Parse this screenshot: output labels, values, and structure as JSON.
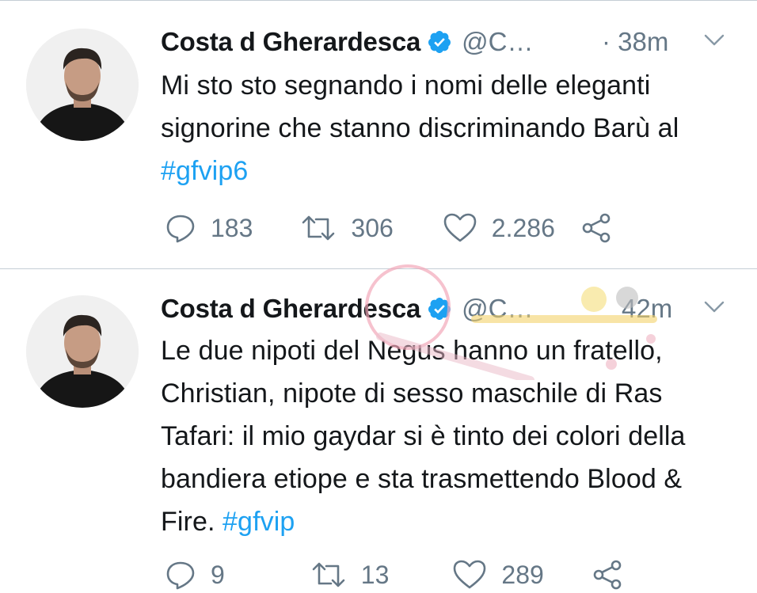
{
  "tweets": [
    {
      "name": "Costa d Gherardesca",
      "handle": "@C…",
      "time": "· 38m",
      "text_plain": "Mi sto sto segnando i nomi delle eleganti signorine che stanno discriminando Barù al ",
      "hashtag": "#gfvip6",
      "replies": "183",
      "retweets": "306",
      "likes": "2.286"
    },
    {
      "name": "Costa d Gherardesca",
      "handle": "@C…",
      "time": "42m",
      "text_plain": "Le due nipoti del Negus hanno un fratello, Christian, nipote di sesso maschile di Ras Tafari: il mio gaydar si è tinto dei colori della bandiera etiope e sta trasmettendo Blood & Fire. ",
      "hashtag": "#gfvip",
      "replies": "9",
      "retweets": "13",
      "likes": "289"
    }
  ],
  "colors": {
    "link": "#1da1f2",
    "verified": "#1da1f2",
    "secondary_text": "#657786",
    "divider": "#c4cdd5"
  },
  "icons": [
    "reply-icon",
    "retweet-icon",
    "like-icon",
    "share-icon",
    "chevron-down-icon",
    "verified-badge-icon"
  ]
}
